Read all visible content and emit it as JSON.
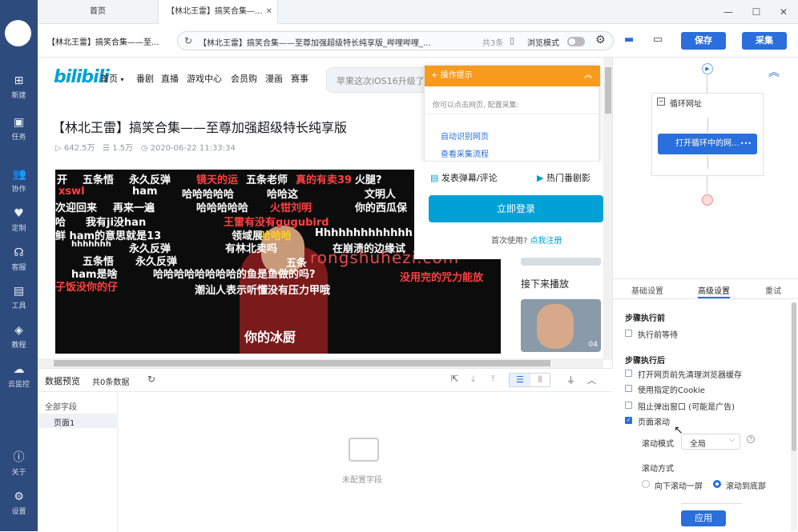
{
  "rail": {
    "items": [
      {
        "label": "新建",
        "icon": "plus-icon"
      },
      {
        "label": "任务",
        "icon": "bookmark-icon"
      },
      {
        "label": "协作",
        "icon": "team-icon"
      },
      {
        "label": "定制",
        "icon": "heart-icon"
      },
      {
        "label": "客服",
        "icon": "headset-icon"
      },
      {
        "label": "工具",
        "icon": "toolbox-icon"
      },
      {
        "label": "教程",
        "icon": "cap-icon"
      },
      {
        "label": "云监控",
        "icon": "cloud-icon"
      }
    ],
    "bottom": [
      {
        "label": "关于",
        "icon": "info-icon"
      },
      {
        "label": "设置",
        "icon": "gear-icon"
      }
    ]
  },
  "tabs": [
    {
      "label": "首页"
    },
    {
      "label": "【林北王雷】搞笑合集—..."
    }
  ],
  "address": {
    "breadcrumb": "【林北王雷】搞笑合集——至...",
    "url": "【林北王雷】搞笑合集——至尊加强超级特长纯享版_哔哩哔哩_...",
    "count": "共3条",
    "browse_mode": "浏览模式",
    "save": "保存",
    "collect": "采集"
  },
  "site": {
    "logo": "bilibili",
    "nav": [
      "首页",
      "番剧",
      "直播",
      "游戏中心",
      "会员购",
      "漫画",
      "赛事"
    ],
    "search_placeholder": "苹果这次iOS16升级了",
    "title": "【林北王雷】搞笑合集——至尊加强超级特长纯享版",
    "views": "642.5万",
    "danmaku": "1.5万",
    "date": "2020-06-22 11:33:34",
    "danmu_lines": [
      "开",
      "五条悟",
      "永久反弹",
      "镜天的运",
      "五条老师",
      "真的有卖39",
      "火腿?",
      "xswl",
      "ham",
      "哈哈哈哈哈",
      "哈哈这",
      "文明人",
      "次迎回来",
      "再来一遍",
      "哈哈哈哈哈",
      "火钳刘明",
      "你的西瓜保",
      "哈",
      "我有ji没han",
      "王雷有没有gugubird",
      "鲜 ham的意思就是13",
      "领域展",
      "哈哈哈",
      "Hhhhhhhhhhhhh",
      "hhhhhhh",
      "永久反弹",
      "有林北卖吗",
      "在崩溃的边缘试",
      "五条悟",
      "永久反弹",
      "五条",
      "ham是啥",
      "哈哈哈哈哈哈哈哈的鱼是鱼做的吗?",
      "没用完的咒力能放",
      "子饭没你的仔",
      "潮汕人表示听懂没有压力甲哦",
      "你的冰厨"
    ],
    "watermark": "rongshuhezi.com",
    "popup_title": "操作提示",
    "popup_hint": "你可以点击网页, 配置采集:",
    "popup_link1": "自动识别网页",
    "popup_link2": "查看采集流程",
    "post_comment": "发表弹幕/评论",
    "hot_show": "热门番剧影",
    "login": "立即登录",
    "first_use": "首次使用?",
    "register": "点我注册",
    "next_play": "接下来播放",
    "thumb_time": "04"
  },
  "preview": {
    "title": "数据预览",
    "count": "共0条数据",
    "all_fields": "全部字段",
    "page1": "页面1",
    "empty": "未配置字段"
  },
  "flow": {
    "loop": "循环网址",
    "open": "打开循环中的网...",
    "more": "•••"
  },
  "settings": {
    "tabs": [
      "基础设置",
      "高级设置",
      "重试"
    ],
    "before": "步骤执行前",
    "wait": "执行前等待",
    "after": "步骤执行后",
    "clear_cache": "打开网页前先清理浏览器缓存",
    "use_cookie": "使用指定的Cookie",
    "block_popup": "阻止弹出窗口 (可能是广告)",
    "page_scroll": "页面滚动",
    "scroll_mode_label": "滚动模式",
    "scroll_mode_value": "全局",
    "scroll_way_label": "滚动方式",
    "scroll_down_one": "向下滚动一屏",
    "scroll_bottom": "滚动到底部",
    "apply": "应用"
  },
  "colors": {
    "rail": "#2e4b7e",
    "accent": "#2a6fdb",
    "bili_blue": "#00a1d6",
    "popup_orange": "#f79a1d"
  }
}
